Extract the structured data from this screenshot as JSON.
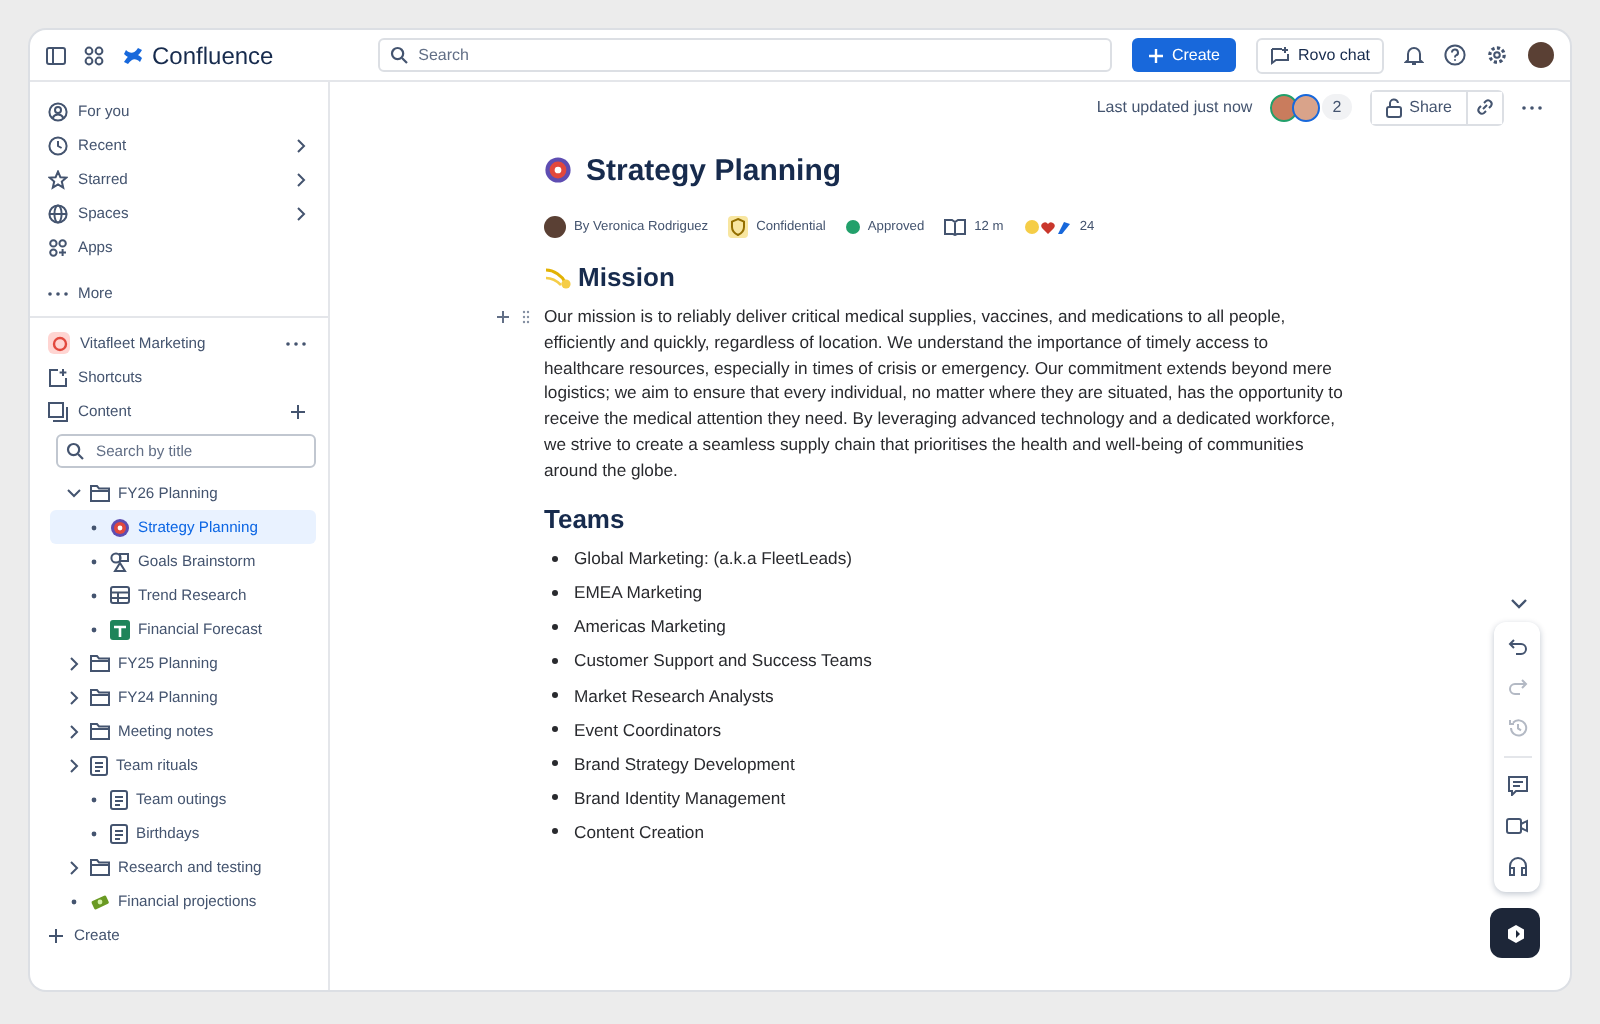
{
  "topbar": {
    "product": "Confluence",
    "search": {
      "placeholder": "Search"
    },
    "create": "Create",
    "rovo": "Rovo chat"
  },
  "sidebar": {
    "nav": [
      {
        "label": "For you",
        "chevron": false
      },
      {
        "label": "Recent",
        "chevron": true
      },
      {
        "label": "Starred",
        "chevron": true
      },
      {
        "label": "Spaces",
        "chevron": true
      },
      {
        "label": "Apps",
        "chevron": false
      }
    ],
    "more": "More",
    "space": "Vitafleet Marketing",
    "shortcuts": "Shortcuts",
    "content": "Content",
    "tree_search": {
      "placeholder": "Search by title"
    },
    "tree": [
      {
        "label": "FY26 Planning",
        "kind": "folder",
        "expanded": true,
        "selected": false,
        "children": [
          {
            "label": "Strategy Planning",
            "kind": "target",
            "selected": true
          },
          {
            "label": "Goals Brainstorm",
            "kind": "whiteboard",
            "selected": false
          },
          {
            "label": "Trend Research",
            "kind": "database",
            "selected": false
          },
          {
            "label": "Financial Forecast",
            "kind": "sheet",
            "selected": false
          }
        ]
      },
      {
        "label": "FY25 Planning",
        "kind": "folder",
        "expanded": false,
        "selected": false
      },
      {
        "label": "FY24 Planning",
        "kind": "folder",
        "expanded": false,
        "selected": false
      },
      {
        "label": "Meeting notes",
        "kind": "folder",
        "expanded": false,
        "selected": false
      },
      {
        "label": "Team rituals",
        "kind": "page",
        "expanded": false,
        "selected": false,
        "children": [
          {
            "label": "Team outings",
            "kind": "page",
            "selected": false
          },
          {
            "label": "Birthdays",
            "kind": "page",
            "selected": false
          }
        ]
      },
      {
        "label": "Research and testing",
        "kind": "folder",
        "expanded": false,
        "selected": false
      },
      {
        "label": "Financial projections",
        "kind": "money",
        "selected": false
      }
    ],
    "create": "Create"
  },
  "page_header": {
    "updated": "Last updated just now",
    "viewer_count": "2",
    "share": "Share"
  },
  "page": {
    "title": "Strategy Planning",
    "byline": {
      "author": "By Veronica Rodriguez",
      "classification": "Confidential",
      "status": "Approved",
      "read_time": "12 m",
      "reactions": "24"
    },
    "mission_heading": "Mission",
    "mission_text": "Our mission is to reliably deliver critical medical supplies, vaccines, and medications to all people, efficiently and quickly, regardless of location. We understand the importance of timely access to healthcare resources, especially in times of crisis or emergency. Our commitment extends beyond mere logistics; we aim to ensure that every individual, no matter where they are situated, has the opportunity to receive the medical attention they need. By leveraging advanced technology and a dedicated workforce, we strive to create a seamless supply chain that prioritises the health and well-being of communities around the globe.",
    "teams_heading": "Teams",
    "teams": [
      "Global Marketing: (a.k.a FleetLeads)",
      "EMEA Marketing",
      "Americas Marketing",
      "Customer Support and Success Teams",
      "Market Research Analysts",
      "Event Coordinators",
      "Brand Strategy Development",
      "Brand Identity Management",
      "Content Creation"
    ]
  }
}
